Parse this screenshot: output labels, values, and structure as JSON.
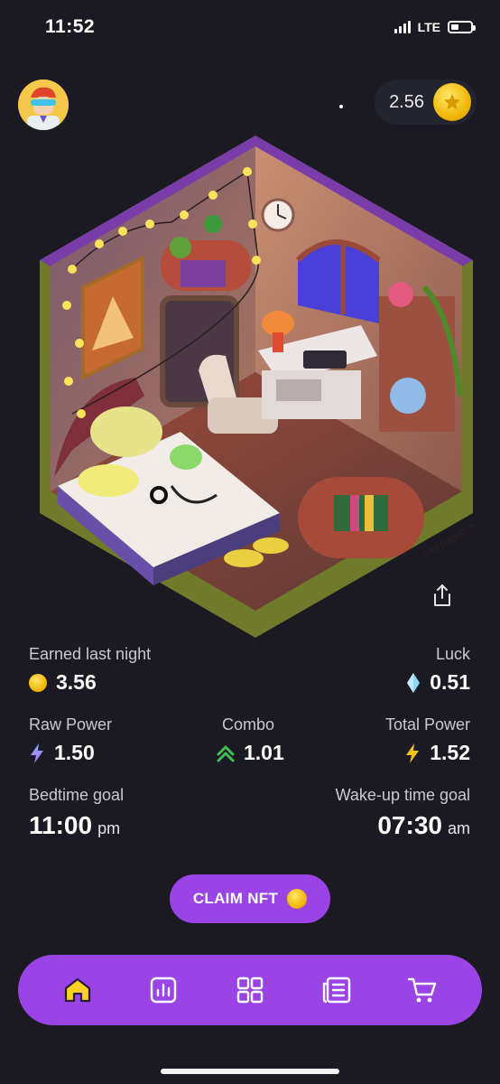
{
  "status_bar": {
    "time": "11:52",
    "network": "LTE"
  },
  "header": {
    "balance": "2.56",
    "avatar_icon": "avatar-icon",
    "coin_icon": "coin-icon"
  },
  "illustration": {
    "signature": "sleepagotchi"
  },
  "stats": {
    "earned_label": "Earned last night",
    "earned_value": "3.56",
    "luck_label": "Luck",
    "luck_value": "0.51",
    "raw_power_label": "Raw Power",
    "raw_power_value": "1.50",
    "combo_label": "Combo",
    "combo_value": "1.01",
    "total_power_label": "Total Power",
    "total_power_value": "1.52"
  },
  "goals": {
    "bedtime_label": "Bedtime goal",
    "bedtime_value": "11:00",
    "bedtime_unit": "pm",
    "wakeup_label": "Wake-up time goal",
    "wakeup_value": "07:30",
    "wakeup_unit": "am"
  },
  "claim_button": {
    "label": "CLAIM NFT"
  },
  "nav": {
    "items": [
      "home-icon",
      "stats-icon",
      "grid-icon",
      "list-icon",
      "cart-icon"
    ]
  },
  "colors": {
    "accent": "#9a44e6",
    "background": "#1b1a22",
    "coin": "#f0b400",
    "active_nav": "#ffd21f"
  }
}
